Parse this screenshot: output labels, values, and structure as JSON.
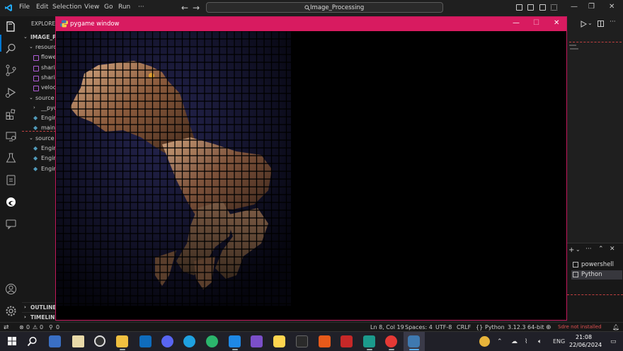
{
  "titlebar": {
    "menu": [
      "File",
      "Edit",
      "Selection",
      "View",
      "Go",
      "Run",
      "···"
    ],
    "search_text": "Image_Processing",
    "window_controls": [
      "—",
      "❐",
      "✕"
    ]
  },
  "explorer": {
    "header": "EXPLORER",
    "project": "IMAGE_PR",
    "rows": [
      {
        "label": "resource",
        "kind": "folder"
      },
      {
        "label": "flowe",
        "kind": "img"
      },
      {
        "label": "sharir",
        "kind": "img"
      },
      {
        "label": "sharir",
        "kind": "img"
      },
      {
        "label": "veloci",
        "kind": "img"
      },
      {
        "label": "source",
        "kind": "folder"
      },
      {
        "label": "__pyc",
        "kind": "folder-closed"
      },
      {
        "label": "Engin",
        "kind": "py"
      },
      {
        "label": "main.",
        "kind": "py"
      },
      {
        "label": "source",
        "kind": "folder"
      },
      {
        "label": "Engin",
        "kind": "py"
      },
      {
        "label": "Engin",
        "kind": "py"
      },
      {
        "label": "Engin",
        "kind": "py"
      }
    ],
    "outline": "OUTLINE",
    "timeline": "TIMELINE"
  },
  "pygame": {
    "title": "pygame window",
    "controls": [
      "—",
      "☐",
      "✕"
    ]
  },
  "terminal": {
    "tabs": [
      "powershell",
      "Python"
    ]
  },
  "statusbar": {
    "errors": "0",
    "warnings": "0",
    "ports": "0",
    "position": "Ln 8, Col 19",
    "spaces": "Spaces: 4",
    "encoding": "UTF-8",
    "eol": "CRLF",
    "language": "Python",
    "interpreter": "3.12.3 64-bit",
    "warning_text": "Sdre not installed"
  },
  "taskbar": {
    "lang": "ENG",
    "time": "21:08",
    "date": "22/06/2024"
  },
  "colors": {
    "pygame_title": "#d81b60",
    "accent": "#0078d4"
  }
}
